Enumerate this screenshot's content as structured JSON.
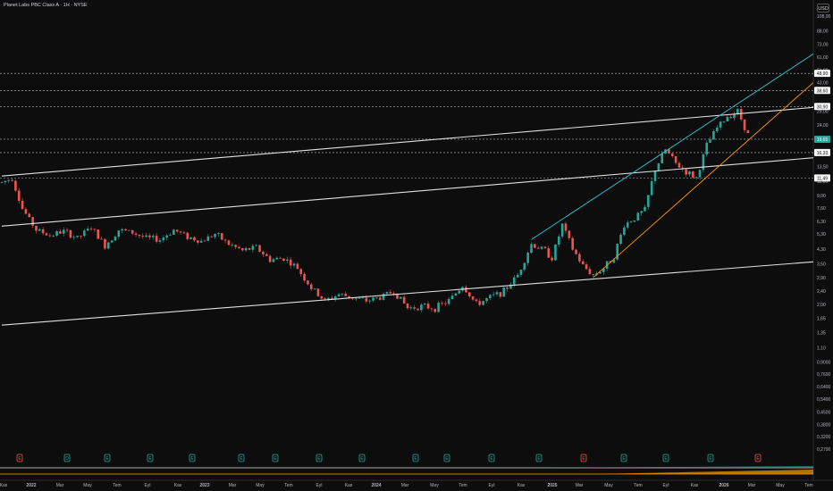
{
  "chart_title": "Planet Labs PBC Class A · 1H · NYSE",
  "currency": "USD",
  "chart_data": {
    "type": "candlestick",
    "scale": "log",
    "colors": {
      "up": "#26a69a",
      "down": "#ef5350",
      "background": "#0d0d0d",
      "channel": "#e0e0e0",
      "cyan_line": "#26c6da",
      "orange_line": "#ff9800"
    },
    "price_axis_ticks": [
      "108,00",
      "88,00",
      "73,00",
      "61,00",
      "51,00",
      "43,00",
      "38,00",
      "29,00",
      "24,00",
      "20,00",
      "16,00",
      "13,50",
      "11,00",
      "9,00",
      "7,60",
      "6,30",
      "5,30",
      "4,30",
      "3,50",
      "2,90",
      "2,40",
      "2,00",
      "1,65",
      "1,35",
      "1,10",
      "0,9000",
      "0,7600",
      "0,6400",
      "0,5400",
      "0,4500",
      "0,3800",
      "0,3200",
      "0,2700"
    ],
    "price_axis_tick_values": [
      108,
      88,
      73,
      61,
      51,
      43,
      38,
      29,
      24,
      20,
      16,
      13.5,
      11,
      9,
      7.6,
      6.3,
      5.3,
      4.3,
      3.5,
      2.9,
      2.4,
      2.0,
      1.65,
      1.35,
      1.1,
      0.9,
      0.76,
      0.64,
      0.54,
      0.45,
      0.38,
      0.32,
      0.27
    ],
    "horizontal_levels": [
      {
        "label": "48,90",
        "value": 48.9
      },
      {
        "label": "38,60",
        "value": 38.6
      },
      {
        "label": "30,90",
        "value": 30.9
      },
      {
        "label": "19,65",
        "value": 19.65,
        "current": true
      },
      {
        "label": "16,33",
        "value": 16.33
      },
      {
        "label": "11,49",
        "value": 11.49
      }
    ],
    "time_axis_labels": [
      "Kas",
      "2022",
      "Mar",
      "May",
      "Tem",
      "Eyl",
      "Kas",
      "2023",
      "Mar",
      "May",
      "Tem",
      "Eyl",
      "Kas",
      "2024",
      "Mar",
      "May",
      "Tem",
      "Eyl",
      "Kas",
      "2025",
      "Mar",
      "May",
      "Tem",
      "Eyl",
      "Kas",
      "2026",
      "Mar",
      "May",
      "Tem"
    ],
    "ohlc_anchors": [
      [
        0,
        10.8
      ],
      [
        3,
        11.5
      ],
      [
        6,
        7.5
      ],
      [
        10,
        5.6
      ],
      [
        14,
        5.2
      ],
      [
        18,
        5.5
      ],
      [
        22,
        5.0
      ],
      [
        26,
        5.8
      ],
      [
        30,
        4.5
      ],
      [
        34,
        5.6
      ],
      [
        38,
        5.4
      ],
      [
        42,
        5.0
      ],
      [
        46,
        4.9
      ],
      [
        50,
        5.6
      ],
      [
        54,
        5.1
      ],
      [
        58,
        4.8
      ],
      [
        62,
        5.3
      ],
      [
        66,
        4.6
      ],
      [
        70,
        4.2
      ],
      [
        74,
        4.4
      ],
      [
        78,
        3.7
      ],
      [
        82,
        3.8
      ],
      [
        86,
        3.3
      ],
      [
        90,
        2.5
      ],
      [
        94,
        2.1
      ],
      [
        98,
        2.3
      ],
      [
        102,
        2.2
      ],
      [
        106,
        2.1
      ],
      [
        110,
        2.2
      ],
      [
        114,
        2.4
      ],
      [
        118,
        1.9
      ],
      [
        122,
        1.95
      ],
      [
        126,
        1.9
      ],
      [
        130,
        2.1
      ],
      [
        134,
        2.6
      ],
      [
        138,
        2.0
      ],
      [
        142,
        2.2
      ],
      [
        146,
        2.4
      ],
      [
        150,
        3.0
      ],
      [
        154,
        4.6
      ],
      [
        158,
        4.2
      ],
      [
        160,
        3.8
      ],
      [
        163,
        6.0
      ],
      [
        166,
        4.3
      ],
      [
        169,
        3.4
      ],
      [
        172,
        3.0
      ],
      [
        175,
        3.3
      ],
      [
        178,
        3.9
      ],
      [
        181,
        6.0
      ],
      [
        184,
        6.6
      ],
      [
        187,
        7.4
      ],
      [
        190,
        13.0
      ],
      [
        193,
        17.0
      ],
      [
        196,
        14.0
      ],
      [
        199,
        12.5
      ],
      [
        202,
        11.5
      ],
      [
        205,
        18.0
      ],
      [
        208,
        23.0
      ],
      [
        211,
        27.0
      ],
      [
        214,
        29.0
      ],
      [
        217,
        21.0
      ]
    ],
    "signal_markers": [
      {
        "label": "E",
        "type": "earnings",
        "color": "#ef5350"
      },
      {
        "label": "D",
        "type": "dividend",
        "color": "#26a69a"
      },
      {
        "label": "E",
        "type": "earnings",
        "color": "#26a69a"
      },
      {
        "label": "E",
        "type": "earnings",
        "color": "#26a69a"
      },
      {
        "label": "E",
        "type": "earnings",
        "color": "#26a69a"
      },
      {
        "label": "E",
        "type": "earnings",
        "color": "#26a69a"
      },
      {
        "label": "E",
        "type": "earnings",
        "color": "#26a69a"
      },
      {
        "label": "E",
        "type": "earnings",
        "color": "#26a69a"
      },
      {
        "label": "E",
        "type": "earnings",
        "color": "#26a69a"
      },
      {
        "label": "E",
        "type": "earnings",
        "color": "#26a69a"
      },
      {
        "label": "E",
        "type": "earnings",
        "color": "#26a69a"
      },
      {
        "label": "E",
        "type": "earnings",
        "color": "#26a69a"
      },
      {
        "label": "E",
        "type": "earnings",
        "color": "#26a69a"
      },
      {
        "label": "E",
        "type": "earnings",
        "color": "#ef5350"
      },
      {
        "label": "E",
        "type": "earnings",
        "color": "#26a69a"
      },
      {
        "label": "E",
        "type": "earnings",
        "color": "#26a69a"
      },
      {
        "label": "E",
        "type": "earnings",
        "color": "#26a69a"
      },
      {
        "label": "E",
        "type": "earnings",
        "color": "#ef5350"
      }
    ],
    "trend_lines": [
      {
        "name": "channel-upper",
        "color": "#e0e0e0",
        "from": [
          0,
          11.8
        ],
        "to": [
          236,
          30.5
        ]
      },
      {
        "name": "channel-middle",
        "color": "#e0e0e0",
        "from": [
          0,
          5.9
        ],
        "to": [
          236,
          15.2
        ]
      },
      {
        "name": "channel-lower",
        "color": "#e0e0e0",
        "from": [
          0,
          1.5
        ],
        "to": [
          236,
          3.6
        ]
      },
      {
        "name": "cyan-trend",
        "color": "#26c6da",
        "from": [
          154,
          4.9
        ],
        "to": [
          236,
          64
        ]
      },
      {
        "name": "orange-trend",
        "color": "#ff9800",
        "from": [
          172,
          2.9
        ],
        "to": [
          236,
          43
        ]
      }
    ]
  }
}
